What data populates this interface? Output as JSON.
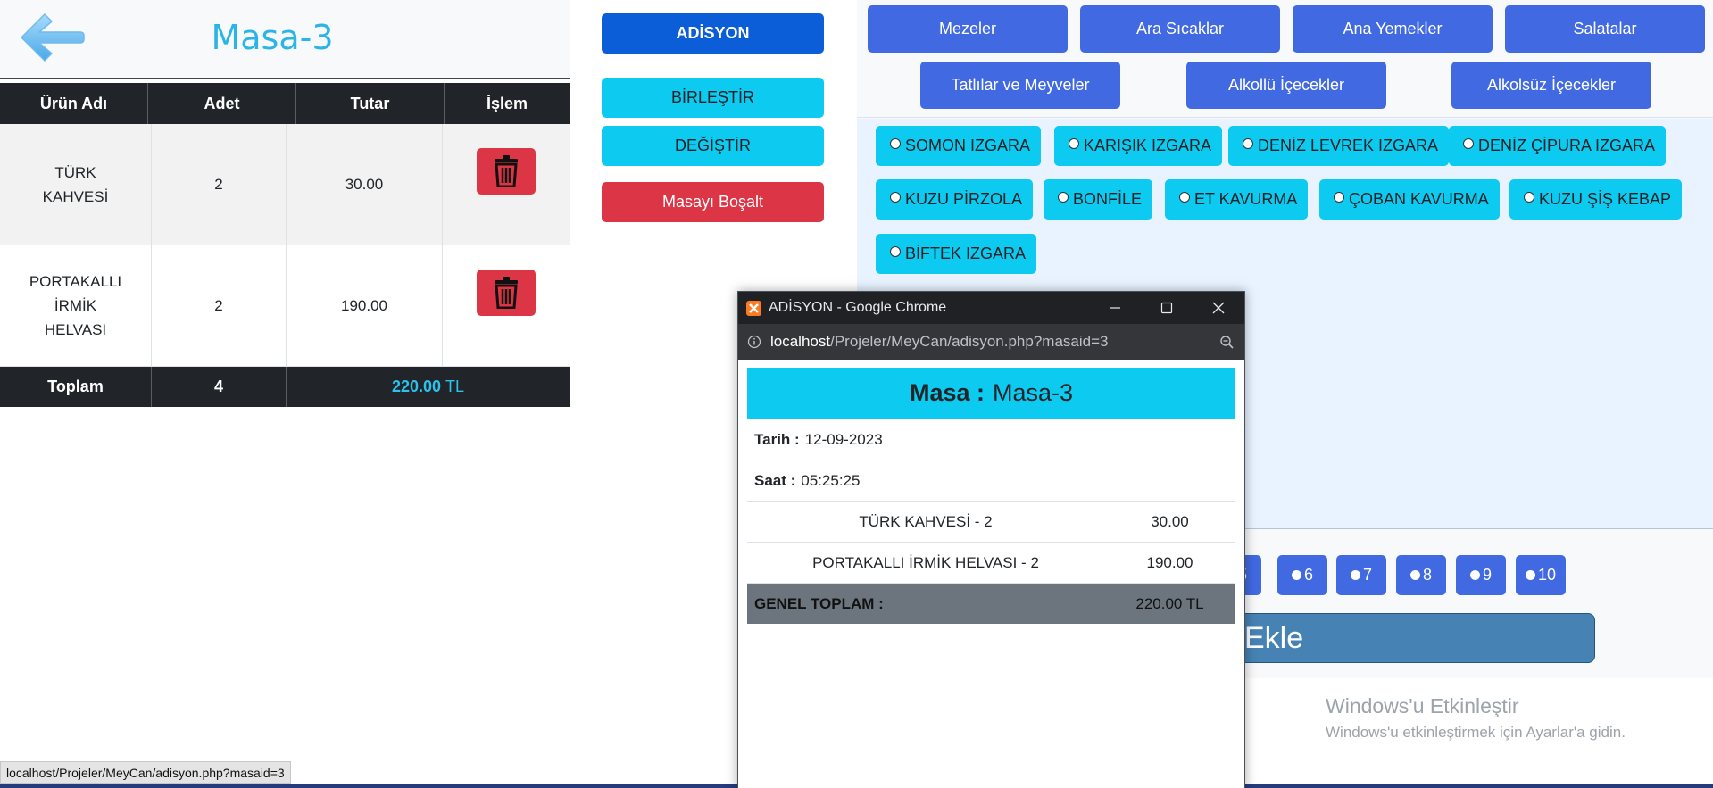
{
  "left": {
    "title": "Masa-3",
    "columns": [
      "Ürün Adı",
      "Adet",
      "Tutar",
      "İşlem"
    ],
    "rows": [
      {
        "name": "TÜRK KAHVESİ",
        "qty": "2",
        "total": "30.00"
      },
      {
        "name": "PORTAKALLI İRMİK HELVASI",
        "qty": "2",
        "total": "190.00"
      }
    ],
    "footer": {
      "label": "Toplam",
      "qty": "4",
      "sum": "220.00",
      "currency": "TL"
    }
  },
  "actions": {
    "adisyon": "ADİSYON",
    "birlestir": "BİRLEŞTİR",
    "degistir": "DEĞİŞTİR",
    "bosalt": "Masayı Boşalt"
  },
  "categories": [
    "Mezeler",
    "Ara Sıcaklar",
    "Ana Yemekler",
    "Salatalar",
    "Tatlılar ve Meyveler",
    "Alkollü İçecekler",
    "Alkolsüz İçecekler"
  ],
  "products": [
    "SOMON IZGARA",
    "KARIŞIK IZGARA",
    "DENİZ LEVREK IZGARA",
    "DENİZ ÇİPURA IZGARA",
    "KUZU PİRZOLA",
    "BONFİLE",
    "ET KAVURMA",
    "ÇOBAN KAVURMA",
    "KUZU ŞİŞ KEBAP",
    "BİFTEK IZGARA"
  ],
  "quantities": [
    "5",
    "6",
    "7",
    "8",
    "9",
    "10"
  ],
  "add_label": "Ekle",
  "windows_activate": {
    "title": "Windows'u Etkinleştir",
    "subtitle": "Windows'u etkinleştirmek için Ayarlar'a gidin."
  },
  "status_url": "localhost/Projeler/MeyCan/adisyon.php?masaid=3",
  "popup": {
    "window_title": "ADİSYON - Google Chrome",
    "url_host": "localhost",
    "url_path": "/Projeler/MeyCan/adisyon.php?masaid=3",
    "masa_label": "Masa :",
    "masa_value": "Masa-3",
    "date_label": "Tarih :",
    "date_value": "12-09-2023",
    "time_label": "Saat :",
    "time_value": "05:25:25",
    "items": [
      {
        "name": "TÜRK KAHVESİ - 2",
        "price": "30.00"
      },
      {
        "name": "PORTAKALLI İRMİK HELVASI - 2",
        "price": "190.00"
      }
    ],
    "total_label": "GENEL TOPLAM :",
    "total_value": "220.00 TL"
  },
  "colors": {
    "title_blue": "#2bb5e6",
    "primary": "#0b5ed7",
    "info": "#0dcaf0",
    "danger": "#dc3545",
    "category": "#4169e1",
    "dark": "#212529"
  }
}
